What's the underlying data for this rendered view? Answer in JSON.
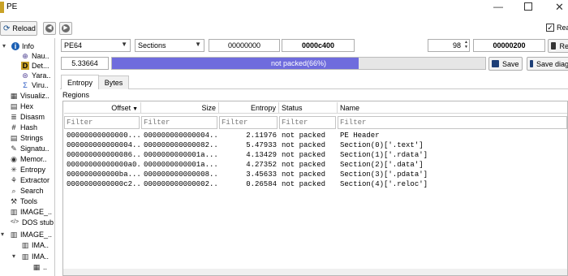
{
  "window": {
    "title": "PE"
  },
  "toolbar": {
    "reload_label": "Reload",
    "readonly_label": "Rea",
    "readonly_checked": "✓"
  },
  "tree": {
    "items": [
      {
        "label": "Info",
        "icon": "info-icon",
        "glyph": "i",
        "color": "#1a5fb4"
      },
      {
        "label": "Nau..",
        "icon": "globe-icon",
        "glyph": "⊕",
        "color": "#4a3d8f"
      },
      {
        "label": "Det...",
        "icon": "die-icon",
        "glyph": "D",
        "color": "#4a3c00"
      },
      {
        "label": "Yara..",
        "icon": "yara-icon",
        "glyph": "⊛",
        "color": "#5a4a9a"
      },
      {
        "label": "Viru..",
        "icon": "virustotal-icon",
        "glyph": "Σ",
        "color": "#2b59c3"
      },
      {
        "label": "Visualiz..",
        "icon": "visualization-icon",
        "glyph": "▦",
        "color": "#333333"
      },
      {
        "label": "Hex",
        "icon": "hex-icon",
        "glyph": "▤",
        "color": "#333333"
      },
      {
        "label": "Disasm",
        "icon": "disasm-icon",
        "glyph": "≣",
        "color": "#333333"
      },
      {
        "label": "Hash",
        "icon": "hash-icon",
        "glyph": "#",
        "color": "#000000"
      },
      {
        "label": "Strings",
        "icon": "strings-icon",
        "glyph": "▤",
        "color": "#333333"
      },
      {
        "label": "Signatu..",
        "icon": "signature-icon",
        "glyph": "✎",
        "color": "#333333"
      },
      {
        "label": "Memor..",
        "icon": "memory-icon",
        "glyph": "◉",
        "color": "#333333"
      },
      {
        "label": "Entropy",
        "icon": "entropy-icon",
        "glyph": "✳",
        "color": "#333333"
      },
      {
        "label": "Extractor",
        "icon": "extractor-icon",
        "glyph": "⚘",
        "color": "#333333"
      },
      {
        "label": "Search",
        "icon": "search-icon",
        "glyph": "⌕",
        "color": "#333333"
      },
      {
        "label": "Tools",
        "icon": "tools-icon",
        "glyph": "⚒",
        "color": "#333333"
      },
      {
        "label": "IMAGE_..",
        "icon": "image-header-icon",
        "glyph": "▥",
        "color": "#333333"
      },
      {
        "label": "DOS stub",
        "icon": "code-icon",
        "glyph": "</>",
        "color": "#333333"
      },
      {
        "label": "IMAGE_..",
        "icon": "image-nt-headers-icon",
        "glyph": "▥",
        "color": "#333333"
      },
      {
        "label": "IMA..",
        "icon": "image-file-header-icon",
        "glyph": "▥",
        "color": "#333333"
      },
      {
        "label": "IMA..",
        "icon": "image-optional-header-icon",
        "glyph": "▥",
        "color": "#333333"
      },
      {
        "label": "..",
        "icon": "table-icon",
        "glyph": "▦",
        "color": "#333333"
      }
    ]
  },
  "controls": {
    "type_value": "PE64",
    "mode_value": "Sections",
    "offset_value": "00000000",
    "size_value": "0000c400",
    "block_count": "98",
    "block_size": "00000200",
    "refresh_label": "Re"
  },
  "entropy": {
    "total": "5.33664",
    "status_label": "not packed(66%)",
    "percent": 66,
    "save_label": "Save",
    "save_diagram_label": "Save diag"
  },
  "tabs": [
    {
      "label": "Entropy",
      "active": true
    },
    {
      "label": "Bytes",
      "active": false
    }
  ],
  "regions": {
    "label": "Regions",
    "headers": [
      "Offset",
      "Size",
      "Entropy",
      "Status",
      "Name"
    ],
    "filter_placeholder": "Filter",
    "rows": [
      {
        "offset": "00000000000000...",
        "size": "000000000000004...",
        "entropy": "2.11976",
        "status": "not packed",
        "name": "PE Header"
      },
      {
        "offset": "000000000000004...",
        "size": "000000000000082...",
        "entropy": "5.47933",
        "status": "not packed",
        "name": "Section(0)['.text']"
      },
      {
        "offset": "000000000000086...",
        "size": "0000000000001a...",
        "entropy": "4.13429",
        "status": "not packed",
        "name": "Section(1)['.rdata']"
      },
      {
        "offset": "00000000000000a0...",
        "size": "0000000000001a...",
        "entropy": "4.27352",
        "status": "not packed",
        "name": "Section(2)['.data']"
      },
      {
        "offset": "000000000000ba...",
        "size": "000000000000008...",
        "entropy": "3.45633",
        "status": "not packed",
        "name": "Section(3)['.pdata']"
      },
      {
        "offset": "0000000000000c2...",
        "size": "000000000000002...",
        "entropy": "0.26584",
        "status": "not packed",
        "name": "Section(4)['.reloc']"
      }
    ]
  }
}
